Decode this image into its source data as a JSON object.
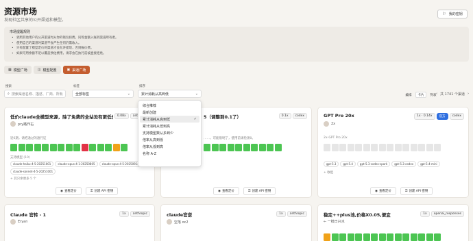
{
  "header": {
    "title": "资源市场",
    "subtitle": "发现社区共享的公开渠道和模型。",
    "my_keys": "我的密钥"
  },
  "notice": {
    "title": "市场提醒规则",
    "items": [
      "调用其他用户的公开渠道时从你的钱包扣费，同等金额入账到渠道所有者。",
      "使用自己的渠道时渠道不会产生任何仍需收入。",
      "只有配置了模型定价的渠道才会允许提现，否则报价费。",
      "如果可用余额不足以覆盖预估费用，请求会在执行前被直接拒绝。"
    ]
  },
  "tabs": [
    "模型广场",
    "模型配置",
    "渠道广场"
  ],
  "filters": {
    "search_label": "搜索",
    "search_placeholder": "搜索渠道名称、描述、厂商、所有",
    "tag_label": "标签",
    "tag_value": "全部标签",
    "sort_label": "排序",
    "sort_value": "累计消耗从高到低"
  },
  "view": {
    "options": [
      "编排",
      "卡片",
      "列表"
    ],
    "selected": "卡片"
  },
  "pager": {
    "prev": "‹",
    "count": "共 1741 个渠道",
    "next": "›"
  },
  "sort_menu": {
    "items": [
      "综合推荐",
      "最新创建",
      "累计消耗从高到低",
      "累计消耗从低到高",
      "支持模型数从多到少",
      "倍率从高到低",
      "倍率从低到高",
      "名称 A-Z"
    ],
    "selected": "累计消耗从高到低"
  },
  "cards": [
    {
      "title": "低价claude全模型来源，除了免费的全站没有更低价",
      "owner": "pry路作右",
      "rate": "0.08x",
      "tag": "anthropic",
      "uptime_label": "近6期，请把通过的通行证",
      "models_label": "支持模型 (10)",
      "models": [
        "claude-haiku-4-5-20251001",
        "claude-opus-4-1-20250805",
        "claude-opus-4-5-20250914",
        "claude-sonnet-4-5-20251001"
      ],
      "more": "+ 其只余更多 5 个",
      "btn_view": "查看定价",
      "btn_key": "创建 API 密钥"
    },
    {
      "title": "5（调整到0.1了）",
      "rate": "0.1x",
      "tag": "codex",
      "desc": "……，可能限制了，使用前请检测0。"
    },
    {
      "title": "GPT Pro 20x",
      "owner": "2x",
      "rate": "1x · 0.14x",
      "tag_blue": "官方",
      "tag": "codex",
      "desc": "2x-GPT Pro 20x",
      "models": [
        "gpt-5.3",
        "gpt-5.4",
        "gpt-5.3-codex-spark",
        "gpt-5.3-codex",
        "gpt-5.4-mini"
      ],
      "more": "+ 收起",
      "btn_view": "查看定价",
      "btn_key": "创建 API 密钥"
    },
    {
      "title": "Claude 官转 - 1",
      "owner": "Eryan",
      "rate": "1x",
      "tag": "anthropic"
    },
    {
      "title": "claude官逆",
      "owner": "空落 oc2",
      "rate": "1x",
      "tag": "anthropic"
    },
    {
      "title": "稳定++plus池,价格X0.05,便宜",
      "owner": "← 一枝日兴水",
      "rate": "1x",
      "tag": "openai_responses"
    }
  ],
  "colors": {
    "accent": "#c45d2f",
    "green": "#4cc552",
    "red": "#e23246",
    "orange": "#f0a21a",
    "empty": "#e6e6e6"
  }
}
